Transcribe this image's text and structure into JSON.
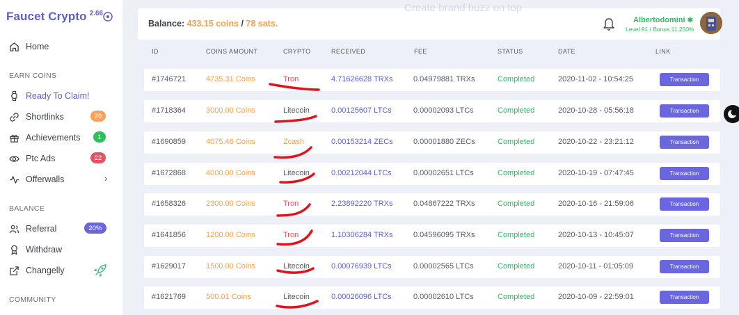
{
  "brand": {
    "name": "Faucet Crypto",
    "version": "2.66"
  },
  "sidebar": {
    "home": "Home",
    "earn_label": "EARN COINS",
    "earn_items": [
      {
        "label": "Ready To Claim!",
        "icon": "watch-icon"
      },
      {
        "label": "Shortlinks",
        "icon": "link-icon",
        "badge": "26",
        "badge_color": "#f7a35c"
      },
      {
        "label": "Achievements",
        "icon": "gift-icon",
        "badge": "1",
        "badge_color": "#2fbf5b"
      },
      {
        "label": "Ptc Ads",
        "icon": "eye-icon",
        "badge": "22",
        "badge_color": "#e25563"
      },
      {
        "label": "Offerwalls",
        "icon": "activity-icon"
      }
    ],
    "balance_label": "BALANCE",
    "balance_items": [
      {
        "label": "Referral",
        "icon": "users-icon",
        "badge": "20%",
        "badge_color": "#6a66de"
      },
      {
        "label": "Withdraw",
        "icon": "award-icon"
      },
      {
        "label": "Changelly",
        "icon": "external-link-icon"
      }
    ],
    "community_label": "COMMUNITY"
  },
  "topbar": {
    "faded_banner": "Create brand buzz on top",
    "balance_label": "Balance:",
    "balance_coins": "433.15 coins",
    "separator": "/",
    "balance_sats": "78 sats.",
    "user_name": "Albertodomini",
    "user_sub": "Level 91 / Bonus 11.250%"
  },
  "table": {
    "headers": [
      "ID",
      "COINS AMOUNT",
      "CRYPTO",
      "RECEIVED",
      "FEE",
      "STATUS",
      "DATE",
      "LINK"
    ],
    "button_label": "Transaction",
    "rows": [
      {
        "id": "#1746721",
        "coins": "4735.31 Coins",
        "crypto": "Tron",
        "crypto_color": "#e25563",
        "received": "4.71626628 TRXs",
        "fee": "0.04979881 TRXs",
        "status": "Completed",
        "date": "2020-11-02 - 10:54:25"
      },
      {
        "id": "#1718364",
        "coins": "3000.00 Coins",
        "crypto": "Litecoin",
        "crypto_color": "#555a65",
        "received": "0.00125607 LTCs",
        "fee": "0.00002093 LTCs",
        "status": "Completed",
        "date": "2020-10-28 - 05:56:18"
      },
      {
        "id": "#1690859",
        "coins": "4075.46 Coins",
        "crypto": "Zcash",
        "crypto_color": "#f0a347",
        "received": "0.00153214 ZECs",
        "fee": "0.00001880 ZECs",
        "status": "Completed",
        "date": "2020-10-22 - 23:21:12"
      },
      {
        "id": "#1672868",
        "coins": "4000.00 Coins",
        "crypto": "Litecoin",
        "crypto_color": "#555a65",
        "received": "0.00212044 LTCs",
        "fee": "0.00002651 LTCs",
        "status": "Completed",
        "date": "2020-10-19 - 07:47:45"
      },
      {
        "id": "#1658326",
        "coins": "2300.00 Coins",
        "crypto": "Tron",
        "crypto_color": "#e25563",
        "received": "2.23892220 TRXs",
        "fee": "0.04867222 TRXs",
        "status": "Completed",
        "date": "2020-10-16 - 21:59:06"
      },
      {
        "id": "#1641856",
        "coins": "1200.00 Coins",
        "crypto": "Tron",
        "crypto_color": "#e25563",
        "received": "1.10306284 TRXs",
        "fee": "0.04596095 TRXs",
        "status": "Completed",
        "date": "2020-10-13 - 10:45:07"
      },
      {
        "id": "#1629017",
        "coins": "1500.00 Coins",
        "crypto": "Litecoin",
        "crypto_color": "#555a65",
        "received": "0.00076939 LTCs",
        "fee": "0.00002565 LTCs",
        "status": "Completed",
        "date": "2020-10-11 - 01:05:09"
      },
      {
        "id": "#1621769",
        "coins": "500.01 Coins",
        "crypto": "Litecoin",
        "crypto_color": "#555a65",
        "received": "0.00026096 LTCs",
        "fee": "0.00002610 LTCs",
        "status": "Completed",
        "date": "2020-10-09 - 22:59:01"
      }
    ]
  },
  "colors": {
    "accent": "#5d5fc9",
    "coins": "#f0a347",
    "status": "#33b864",
    "scribble": "#e0141e"
  }
}
